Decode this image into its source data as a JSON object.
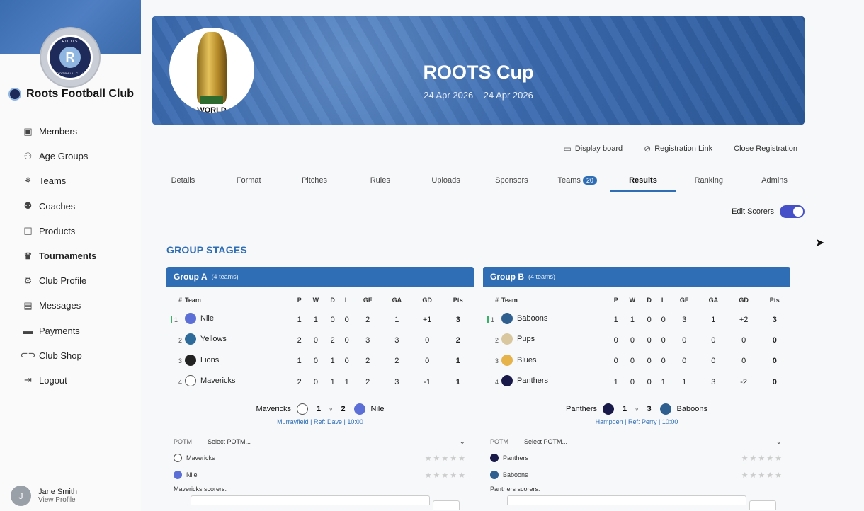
{
  "club": {
    "name": "Roots Football Club",
    "logo_top": "ROOTS",
    "logo_bottom": "FOOTBALL CLUB"
  },
  "nav": [
    {
      "label": "Members",
      "icon": "members-icon",
      "glyph": "▣"
    },
    {
      "label": "Age Groups",
      "icon": "age-groups-icon",
      "glyph": "⚇"
    },
    {
      "label": "Teams",
      "icon": "teams-icon",
      "glyph": "⚘"
    },
    {
      "label": "Coaches",
      "icon": "coaches-icon",
      "glyph": "⚉"
    },
    {
      "label": "Products",
      "icon": "products-icon",
      "glyph": "◫"
    },
    {
      "label": "Tournaments",
      "icon": "trophy-icon",
      "glyph": "♛"
    },
    {
      "label": "Club Profile",
      "icon": "gear-icon",
      "glyph": "⚙"
    },
    {
      "label": "Messages",
      "icon": "message-icon",
      "glyph": "▤"
    },
    {
      "label": "Payments",
      "icon": "card-icon",
      "glyph": "▬"
    },
    {
      "label": "Club Shop",
      "icon": "link-icon",
      "glyph": "⊂⊃"
    },
    {
      "label": "Logout",
      "icon": "logout-icon",
      "glyph": "⇥"
    }
  ],
  "user": {
    "initial": "J",
    "name": "Jane Smith",
    "link": "View Profile"
  },
  "hero": {
    "title": "ROOTS Cup",
    "date": "24 Apr 2026 – 24 Apr 2026",
    "trophy_text": "WORLD"
  },
  "actions": {
    "display_board": "Display board",
    "registration_link": "Registration Link",
    "close_registration": "Close Registration"
  },
  "tabs": [
    {
      "label": "Details"
    },
    {
      "label": "Format"
    },
    {
      "label": "Pitches"
    },
    {
      "label": "Rules"
    },
    {
      "label": "Uploads"
    },
    {
      "label": "Sponsors"
    },
    {
      "label": "Teams",
      "badge": "20"
    },
    {
      "label": "Results",
      "active": true
    },
    {
      "label": "Ranking"
    },
    {
      "label": "Admins"
    }
  ],
  "edit_scorers": "Edit Scorers",
  "section_title": "GROUP STAGES",
  "columns": [
    "#",
    "Team",
    "P",
    "W",
    "D",
    "L",
    "GF",
    "GA",
    "GD",
    "Pts"
  ],
  "groups": [
    {
      "name": "Group A",
      "count": "(4 teams)",
      "rows": [
        {
          "rank": "1",
          "team": "Nile",
          "p": "1",
          "w": "1",
          "d": "0",
          "l": "0",
          "gf": "2",
          "ga": "1",
          "gd": "+1",
          "pts": "3"
        },
        {
          "rank": "2",
          "team": "Yellows",
          "p": "2",
          "w": "0",
          "d": "2",
          "l": "0",
          "gf": "3",
          "ga": "3",
          "gd": "0",
          "pts": "2"
        },
        {
          "rank": "3",
          "team": "Lions",
          "p": "1",
          "w": "0",
          "d": "1",
          "l": "0",
          "gf": "2",
          "ga": "2",
          "gd": "0",
          "pts": "1"
        },
        {
          "rank": "4",
          "team": "Mavericks",
          "p": "2",
          "w": "0",
          "d": "1",
          "l": "1",
          "gf": "2",
          "ga": "3",
          "gd": "-1",
          "pts": "1"
        }
      ],
      "match": {
        "home": "Mavericks",
        "home_score": "1",
        "vs": "v",
        "away_score": "2",
        "away": "Nile",
        "meta": "Murrayfield |  Ref: Dave |  10:00"
      },
      "potm_label": "POTM",
      "potm_placeholder": "Select POTM...",
      "scorers_label": "Mavericks scorers:"
    },
    {
      "name": "Group B",
      "count": "(4 teams)",
      "rows": [
        {
          "rank": "1",
          "team": "Baboons",
          "p": "1",
          "w": "1",
          "d": "0",
          "l": "0",
          "gf": "3",
          "ga": "1",
          "gd": "+2",
          "pts": "3"
        },
        {
          "rank": "2",
          "team": "Pups",
          "p": "0",
          "w": "0",
          "d": "0",
          "l": "0",
          "gf": "0",
          "ga": "0",
          "gd": "0",
          "pts": "0"
        },
        {
          "rank": "3",
          "team": "Blues",
          "p": "0",
          "w": "0",
          "d": "0",
          "l": "0",
          "gf": "0",
          "ga": "0",
          "gd": "0",
          "pts": "0"
        },
        {
          "rank": "4",
          "team": "Panthers",
          "p": "1",
          "w": "0",
          "d": "0",
          "l": "1",
          "gf": "1",
          "ga": "3",
          "gd": "-2",
          "pts": "0"
        }
      ],
      "match": {
        "home": "Panthers",
        "home_score": "1",
        "vs": "v",
        "away_score": "3",
        "away": "Baboons",
        "meta": "Hampden |  Ref: Perry |  10:00"
      },
      "potm_label": "POTM",
      "potm_placeholder": "Select POTM...",
      "scorers_label": "Panthers scorers:"
    }
  ],
  "colors": {
    "primary": "#2f6db4",
    "toggle": "#4550c8",
    "positive": "#2f9a4b",
    "negative": "#d03a3a"
  },
  "crests": {
    "Nile": "#5b6fd6",
    "Yellows": "#2e6a9a",
    "Lions": "#222222",
    "Mavericks": "#ffffff",
    "Baboons": "#2f5f8f",
    "Pups": "#d9c7a0",
    "Blues": "#e6b24a",
    "Panthers": "#1a1a4a"
  }
}
